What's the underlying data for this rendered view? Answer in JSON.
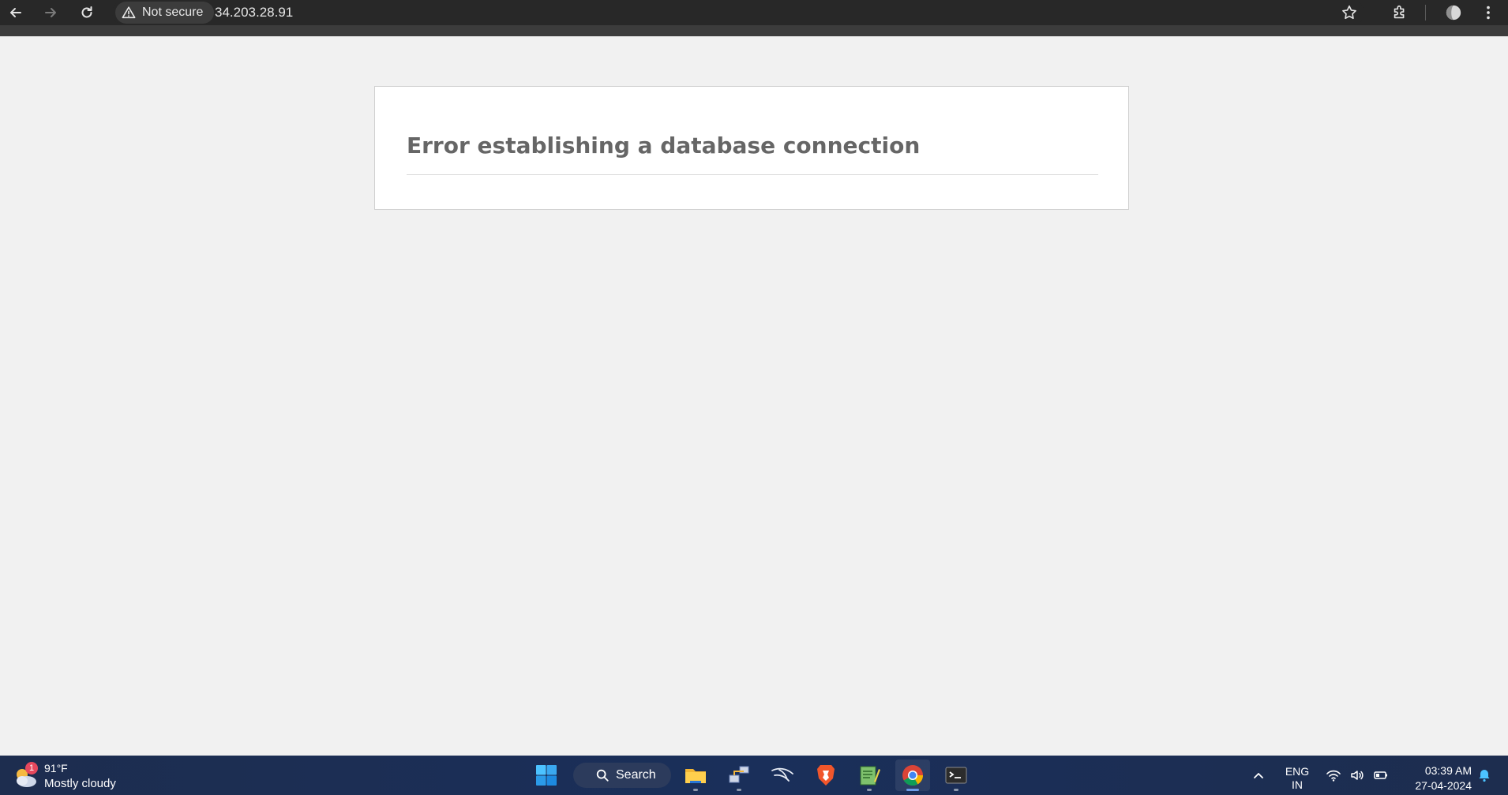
{
  "browser": {
    "security_label": "Not secure",
    "url": "34.203.28.91",
    "icons": [
      "back-arrow-icon",
      "forward-arrow-icon",
      "reload-icon",
      "warning-icon",
      "star-icon",
      "extensions-icon",
      "profile-icon",
      "menu-kebab-icon"
    ]
  },
  "page": {
    "error_message": "Error establishing a database connection"
  },
  "taskbar": {
    "weather": {
      "badge": "1",
      "temperature": "91°F",
      "condition": "Mostly cloudy"
    },
    "search_label": "Search",
    "apps": [
      "windows-start-icon",
      "file-explorer-icon",
      "network-app-icon",
      "kali-icon",
      "brave-browser-icon",
      "notepad-icon",
      "chrome-icon",
      "terminal-icon"
    ],
    "language": {
      "line1": "ENG",
      "line2": "IN"
    },
    "clock": {
      "time": "03:39 AM",
      "date": "27-04-2024"
    },
    "accent_color": "#6c9ce8"
  }
}
